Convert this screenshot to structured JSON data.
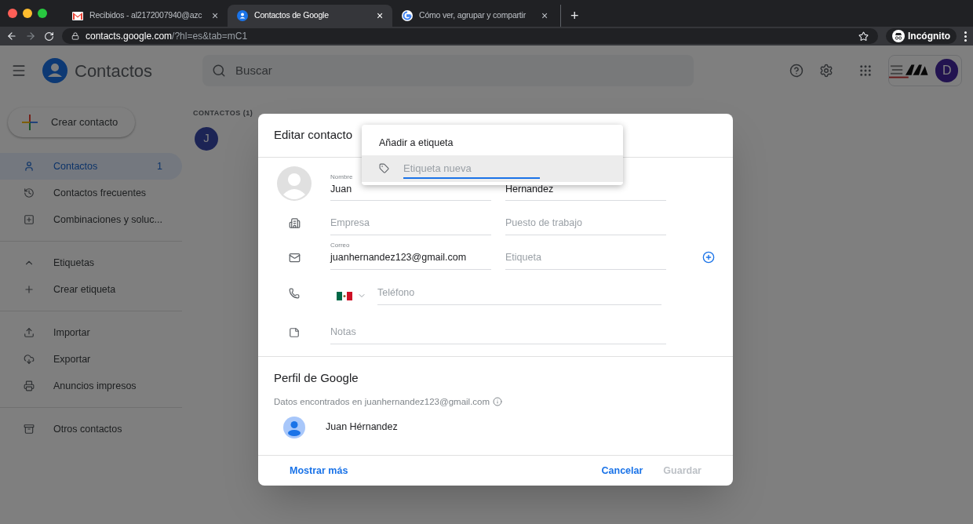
{
  "browser": {
    "tabs": [
      {
        "title": "Recibidos - al2172007940@azc",
        "close": "×",
        "selected": false,
        "kind": "mail"
      },
      {
        "title": "Contactos de Google",
        "close": "×",
        "selected": true,
        "kind": "contacts"
      },
      {
        "title": "Cómo ver, agrupar y compartir",
        "close": "×",
        "selected": false,
        "kind": "google"
      }
    ],
    "new_tab": "+",
    "url_host": "contacts.google.com",
    "url_path": "/?hl=es&tab=mC1",
    "incognito": "Incógnito"
  },
  "app": {
    "title": "Contactos",
    "search": {
      "placeholder": "Buscar"
    },
    "avatar": "D",
    "create_button": "Crear contacto",
    "sidebar": [
      {
        "kind": "person",
        "label": "Contactos",
        "count": "1",
        "selected": true
      },
      {
        "kind": "history",
        "label": "Contactos frecuentes",
        "selected": false
      },
      {
        "kind": "merge",
        "label": "Combinaciones y soluc...",
        "selected": false
      },
      {
        "kind": "divider"
      },
      {
        "kind": "chevron",
        "label": "Etiquetas",
        "selected": false
      },
      {
        "kind": "plus",
        "label": "Crear etiqueta",
        "selected": false
      },
      {
        "kind": "divider"
      },
      {
        "kind": "upload",
        "label": "Importar",
        "selected": false
      },
      {
        "kind": "cloud",
        "label": "Exportar",
        "selected": false
      },
      {
        "kind": "print",
        "label": "Anuncios impresos",
        "selected": false
      },
      {
        "kind": "divider"
      },
      {
        "kind": "archive",
        "label": "Otros contactos",
        "selected": false
      }
    ],
    "list_heading": "CONTACTOS (1)",
    "contacts": [
      {
        "initial": "J"
      }
    ]
  },
  "dialog": {
    "title": "Editar contacto",
    "first_name": {
      "label": "Nombre",
      "value": "Juan"
    },
    "last_name": {
      "value": "Hernandez"
    },
    "company": {
      "placeholder": "Empresa"
    },
    "job": {
      "placeholder": "Puesto de trabajo"
    },
    "email": {
      "label": "Correo",
      "value": "juanhernandez123@gmail.com"
    },
    "email_label": {
      "placeholder": "Etiqueta"
    },
    "phone": {
      "placeholder": "Teléfono"
    },
    "notes": {
      "placeholder": "Notas"
    },
    "profile_title": "Perfil de Google",
    "profile_note": "Datos encontrados en juanhernandez123@gmail.com",
    "profile_name": "Juan Hérnandez",
    "more": "Mostrar más",
    "cancel": "Cancelar",
    "save": "Guardar",
    "save_disabled": true
  },
  "label_menu": {
    "title": "Añadir a etiqueta",
    "input": {
      "placeholder": "Etiqueta nueva"
    }
  }
}
